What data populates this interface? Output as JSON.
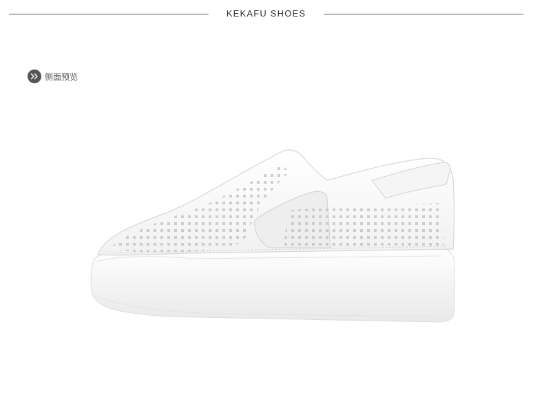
{
  "header": {
    "brand": "KEKAFU SHOES"
  },
  "section": {
    "label": "侧面预览",
    "icon": "double-chevron-right-icon"
  },
  "product": {
    "image": "white-perforated-slip-on-shoe",
    "colors": {
      "upper": "#f7f7f7",
      "sole": "#f3f3f3",
      "perforation": "#c8c8c8",
      "elastic": "#eeeeee"
    }
  }
}
